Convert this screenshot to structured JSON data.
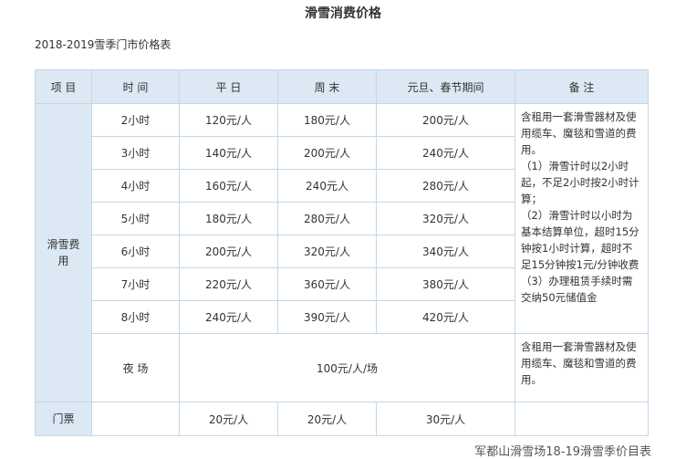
{
  "title": "滑雪消费价格",
  "subtitle": "2018-2019雪季门市价格表",
  "table": {
    "headers": [
      "项 目",
      "时 间",
      "平 日",
      "周 末",
      "元旦、春节期间",
      "备 注"
    ],
    "category_ski": "滑雪费用",
    "rows": [
      {
        "time": "2小时",
        "weekday": "120元/人",
        "weekend": "180元/人",
        "holiday": "200元/人"
      },
      {
        "time": "3小时",
        "weekday": "140元/人",
        "weekend": "200元/人",
        "holiday": "240元/人"
      },
      {
        "time": "4小时",
        "weekday": "160元/人",
        "weekend": "240元人",
        "holiday": "280元/人"
      },
      {
        "time": "5小时",
        "weekday": "180元/人",
        "weekend": "280元/人",
        "holiday": "320元/人"
      },
      {
        "time": "6小时",
        "weekday": "200元/人",
        "weekend": "320元/人",
        "holiday": "340元/人"
      },
      {
        "time": "7小时",
        "weekday": "220元/人",
        "weekend": "360元/人",
        "holiday": "380元/人"
      },
      {
        "time": "8小时",
        "weekday": "240元/人",
        "weekend": "390元/人",
        "holiday": "420元/人"
      }
    ],
    "notes_day": [
      "含租用一套滑雪器材及使",
      "用缆车、魔毯和雪道的费",
      "用。",
      "（1）滑雪计时以2小时",
      "起，不足2小时按2小时计",
      "算；",
      "（2）滑雪计时以小时为",
      "基本结算单位，超时15分",
      "钟按1小时计算，超时不",
      "足15分钟按1元/分钟收费",
      "（3）办理租赁手续时需",
      "交纳50元储值金"
    ],
    "night": {
      "time": "夜 场",
      "price": "100元/人/场",
      "notes": [
        "含租用一套滑雪器材及使",
        "用缆车、魔毯和雪道的费",
        "用。"
      ]
    },
    "ticket": {
      "label": "门票",
      "time": "",
      "weekday": "20元/人",
      "weekend": "20元/人",
      "holiday": "30元/人",
      "note": ""
    }
  },
  "caption": "军都山滑雪场18-19滑雪季价目表"
}
